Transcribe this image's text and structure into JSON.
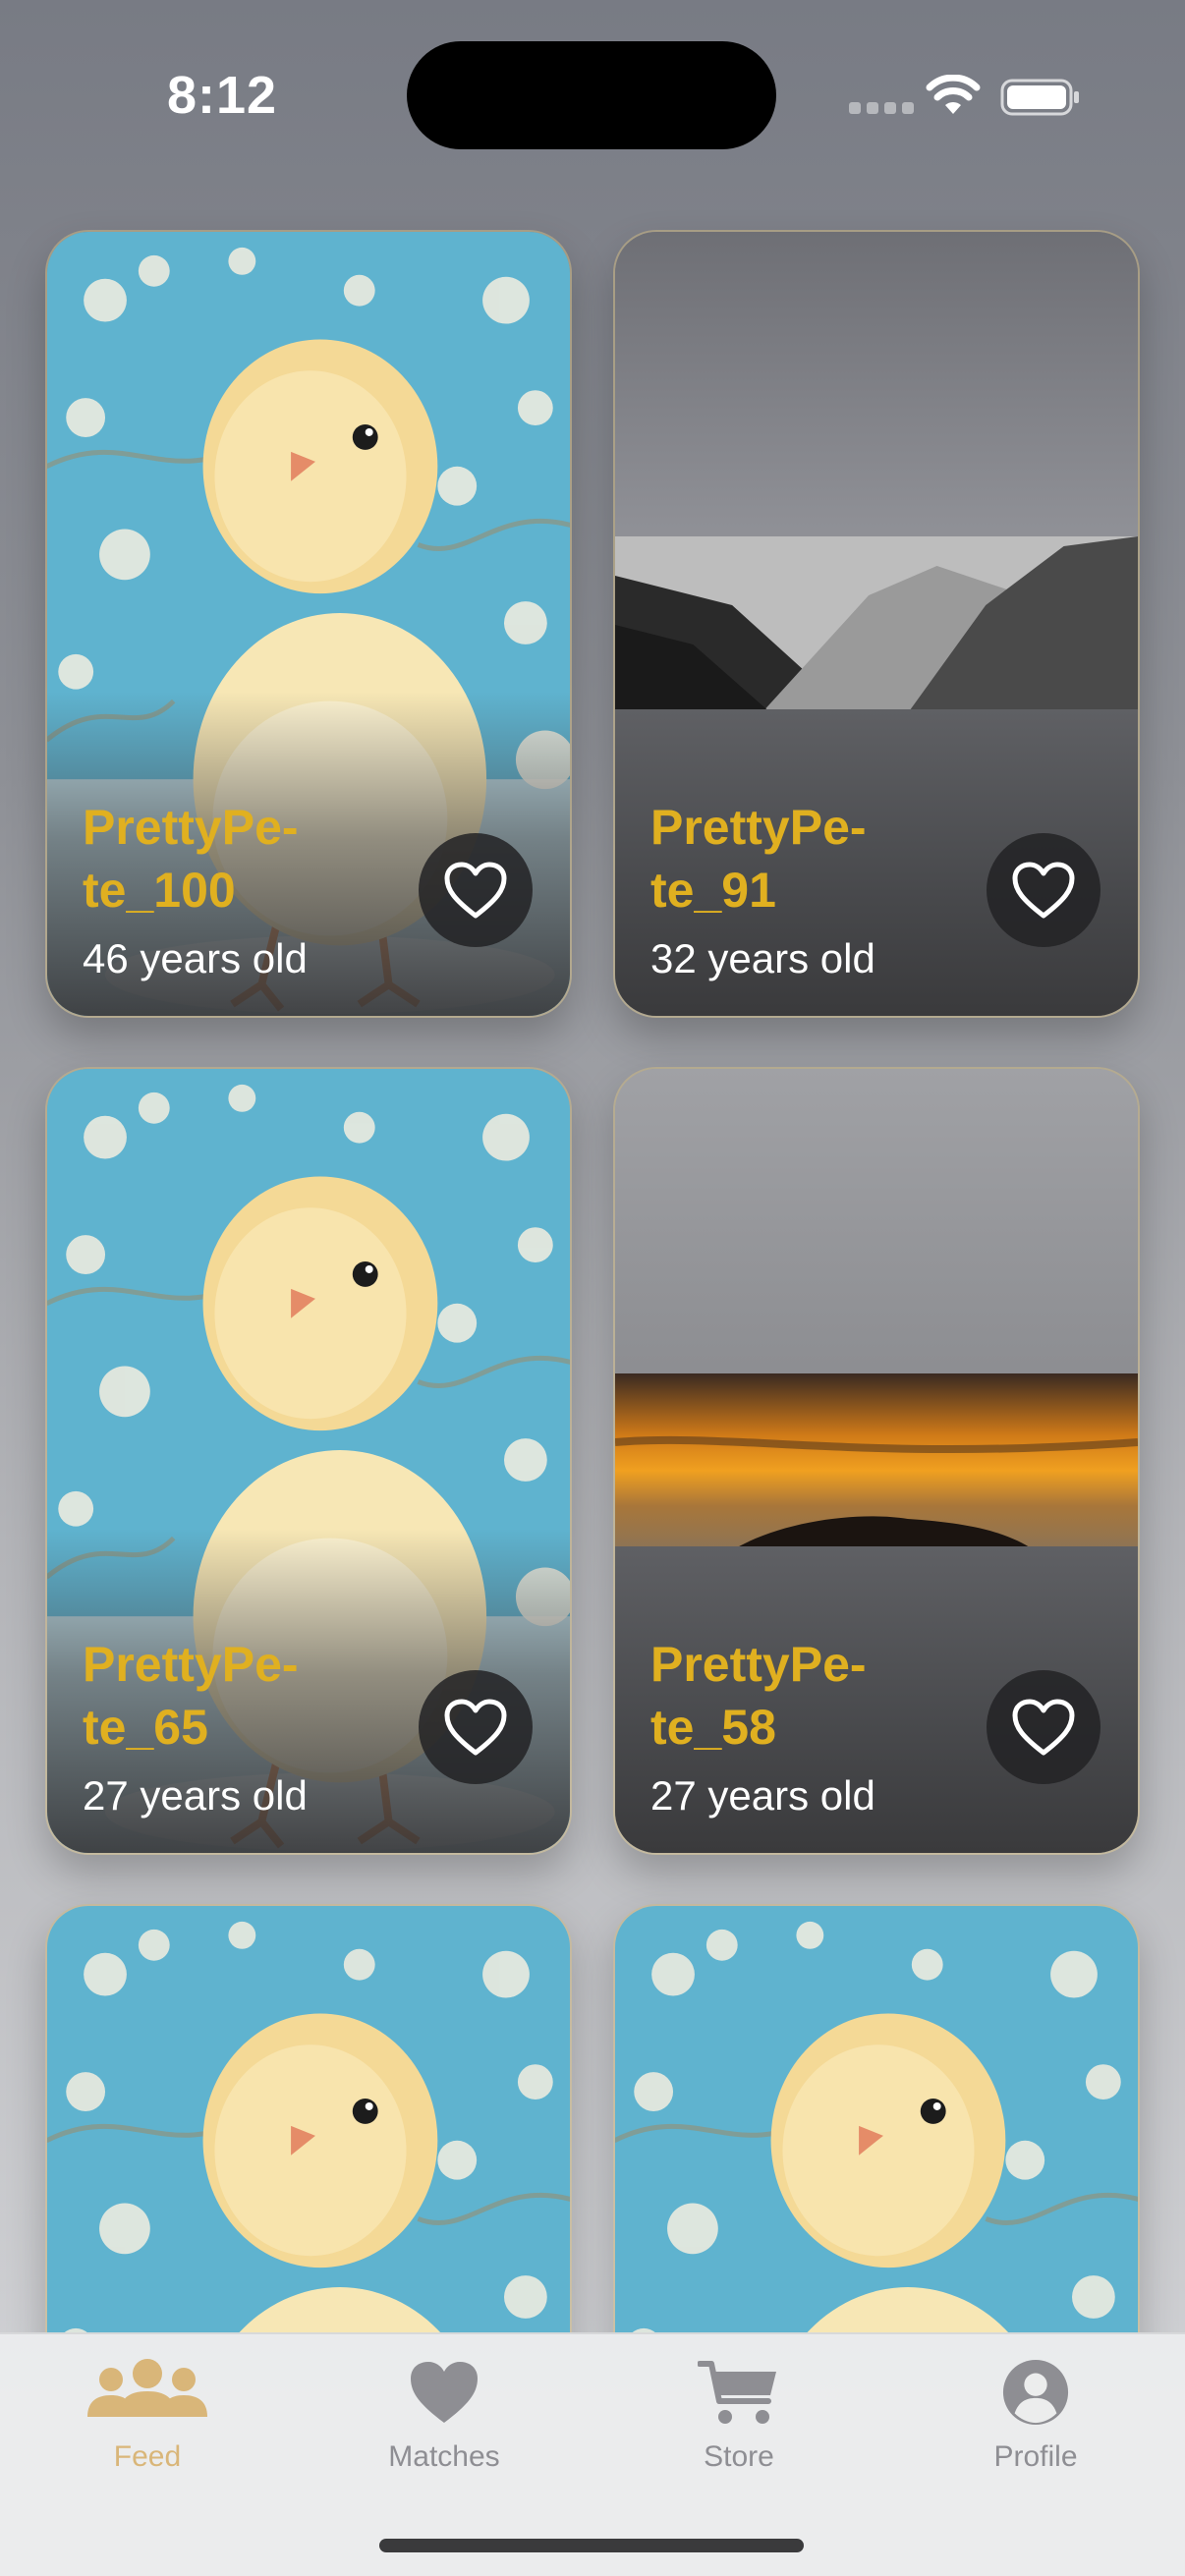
{
  "status_bar": {
    "time": "8:12"
  },
  "cards": [
    {
      "name": "PrettyPe-te_100",
      "age": "46 years old",
      "photo": "chick"
    },
    {
      "name": "PrettyPe-te_91",
      "age": "32 years old",
      "photo": "mountains"
    },
    {
      "name": "PrettyPe-te_65",
      "age": "27 years old",
      "photo": "chick"
    },
    {
      "name": "PrettyPe-te_58",
      "age": "27 years old",
      "photo": "sunset"
    },
    {
      "name": "",
      "age": "",
      "photo": "chick"
    },
    {
      "name": "",
      "age": "",
      "photo": "chick"
    }
  ],
  "tabs": [
    {
      "label": "Feed",
      "icon": "people-icon",
      "active": true
    },
    {
      "label": "Matches",
      "icon": "heart-icon",
      "active": false
    },
    {
      "label": "Store",
      "icon": "cart-icon",
      "active": false
    },
    {
      "label": "Profile",
      "icon": "person-circle-icon",
      "active": false
    }
  ],
  "colors": {
    "accent": "#e0b020",
    "tab_active": "#d9b679",
    "tab_inactive": "#8e8e93"
  }
}
